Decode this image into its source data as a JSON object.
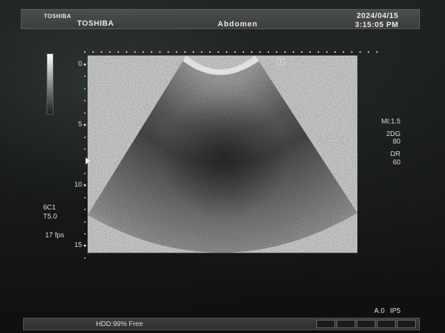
{
  "header": {
    "logo_small": "TOSHIBA",
    "logo_main": "TOSHIBA",
    "exam": "Abdomen",
    "date": "2024/04/15",
    "time": "3:15:05 PM"
  },
  "depth_scale": {
    "labels": [
      "0",
      "5",
      "10",
      "15"
    ],
    "unit": "cm"
  },
  "left_params": {
    "probe": "6C1",
    "transducer": "T5.0",
    "fps": "17 fps"
  },
  "right_params": {
    "mi": "MI:1.5",
    "mode_label": "2DG",
    "gain": "80",
    "dr_label": "DR",
    "dr": "60"
  },
  "status": {
    "hdd": "HDD:99% Free",
    "ao": "A.0",
    "ip": "IP5"
  },
  "icons": {
    "top_marker": "T"
  }
}
